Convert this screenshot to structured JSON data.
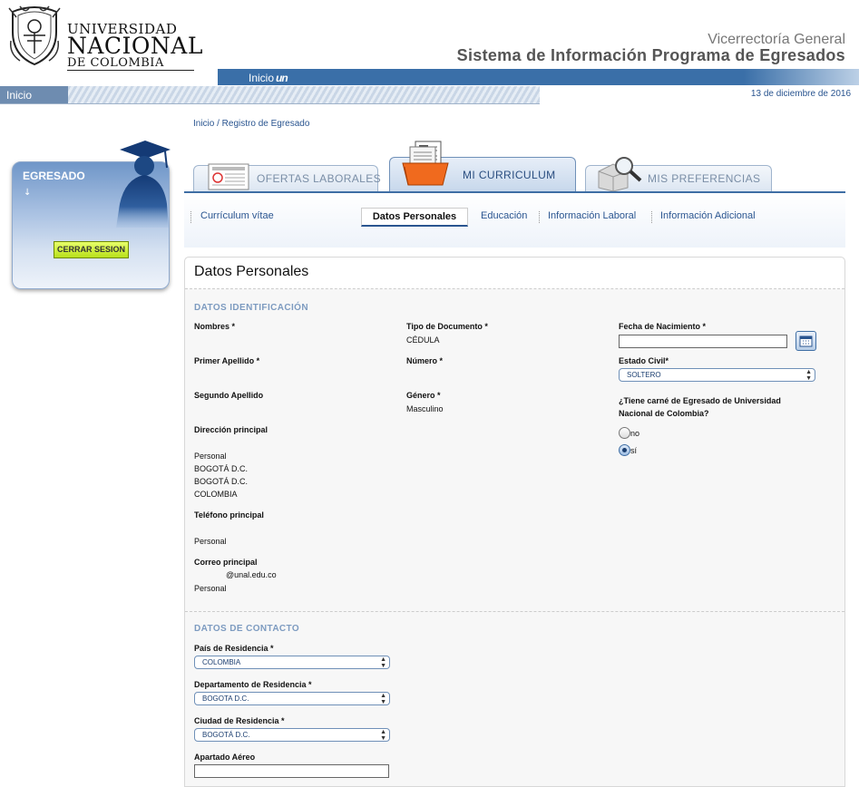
{
  "header": {
    "university_line1": "UNIVERSIDAD",
    "university_line2": "NACIONAL",
    "university_line3": "DE COLOMBIA",
    "subtitle": "Vicerrectoría General",
    "title": "Sistema de Información Programa de Egresados",
    "inicio_un_label": "Inicio",
    "inicio_un_mark": "un"
  },
  "navbar": {
    "home_label": "Inicio",
    "date": "13 de diciembre de 2016"
  },
  "breadcrumb": "Inicio / Registro de Egresado",
  "sidebar": {
    "title": "EGRESADO",
    "arrow": "↓",
    "logout_label": "CERRAR SESION"
  },
  "tabs": [
    {
      "label": "OFERTAS LABORALES",
      "icon": "newspaper-icon"
    },
    {
      "label": "MI CURRICULUM",
      "icon": "folder-documents-icon"
    },
    {
      "label": "MIS PREFERENCIAS",
      "icon": "magnifier-box-icon"
    }
  ],
  "subnav": {
    "items": [
      "Currículum vítae",
      "Datos Personales",
      "Educación",
      "Información Laboral",
      "Información Adicional"
    ],
    "active": "Datos Personales"
  },
  "content": {
    "title": "Datos Personales",
    "identification": {
      "section_title": "DATOS IDENTIFICACIÓN",
      "nombres_label": "Nombres *",
      "primer_apellido_label": "Primer Apellido *",
      "segundo_apellido_label": "Segundo Apellido",
      "direccion_label": "Dirección principal",
      "direccion_lines": [
        "Personal",
        "BOGOTÁ D.C.",
        "BOGOTÁ D.C.",
        "COLOMBIA"
      ],
      "telefono_label": "Teléfono principal",
      "telefono_type": "Personal",
      "correo_label": "Correo principal",
      "correo_value": "@unal.edu.co",
      "correo_type": "Personal",
      "tipo_doc_label": "Tipo de Documento *",
      "tipo_doc_value": "CÉDULA",
      "numero_label": "Número *",
      "genero_label": "Género *",
      "genero_value": "Masculino",
      "fecha_nac_label": "Fecha de Nacimiento *",
      "fecha_nac_value": "",
      "estado_civil_label": "Estado Civil*",
      "estado_civil_value": "SOLTERO",
      "carne_question_line1": "¿Tiene carné de Egresado de Universidad",
      "carne_question_line2": "Nacional de Colombia?",
      "carne_option_no": "no",
      "carne_option_si": "sí",
      "carne_selected": "sí"
    },
    "contact": {
      "section_title": "DATOS DE CONTACTO",
      "pais_label": "País de Residencia *",
      "pais_value": "COLOMBIA",
      "departamento_label": "Departamento de Residencia *",
      "departamento_value": "BOGOTA D.C.",
      "ciudad_label": "Ciudad de Residencia *",
      "ciudad_value": "BOGOTÁ D.C.",
      "apartado_label": "Apartado Aéreo",
      "apartado_value": ""
    }
  },
  "colors": {
    "primary_blue": "#3a6fa8",
    "link_blue": "#2a5590",
    "section_title": "#7d9bc0",
    "logout_button": "#c8ec2a"
  }
}
